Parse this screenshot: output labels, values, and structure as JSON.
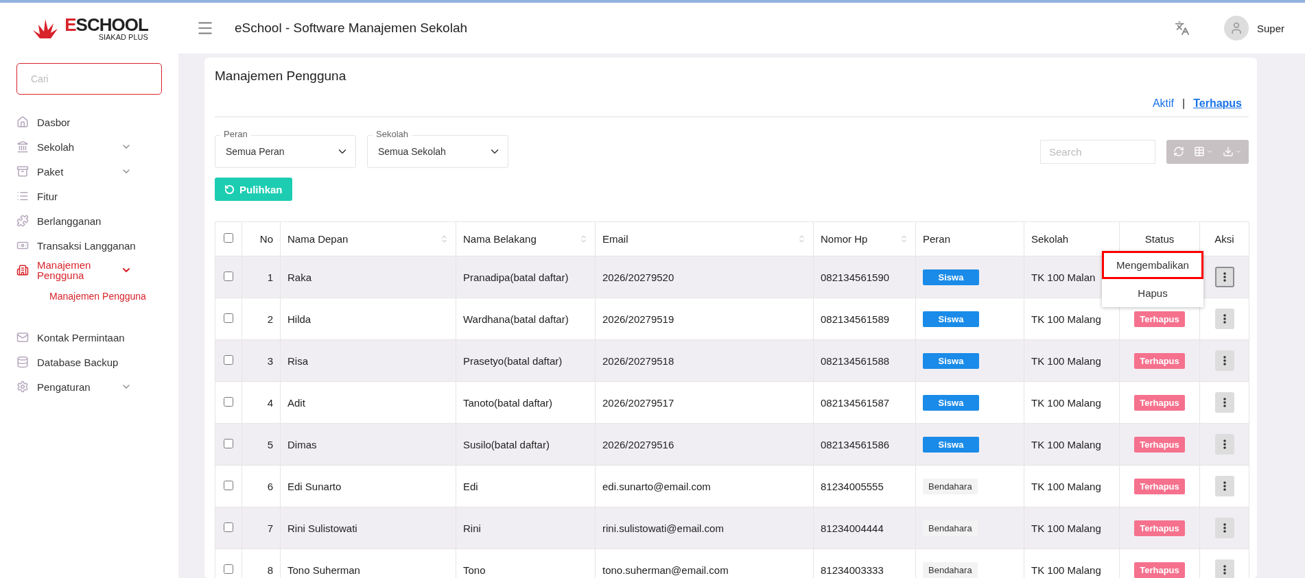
{
  "header": {
    "logo": {
      "brand": "ESCHOOL",
      "tagline": "SIAKAD PLUS"
    },
    "title": "eSchool - Software Manajemen Sekolah",
    "user": "Super"
  },
  "sidebar": {
    "search_placeholder": "Cari",
    "items": [
      {
        "label": "Dasbor",
        "expandable": false,
        "selected": false
      },
      {
        "label": "Sekolah",
        "expandable": true,
        "expanded": false,
        "selected": false
      },
      {
        "label": "Paket",
        "expandable": true,
        "expanded": false,
        "selected": false
      },
      {
        "label": "Fitur",
        "expandable": false,
        "selected": false
      },
      {
        "label": "Berlangganan",
        "expandable": false,
        "selected": false
      },
      {
        "label": "Transaksi Langganan",
        "expandable": false,
        "selected": false
      },
      {
        "label": "Manajemen Pengguna",
        "expandable": true,
        "expanded": true,
        "selected": true,
        "children": [
          {
            "label": "Manajemen Pengguna",
            "selected": true
          }
        ]
      },
      {
        "label": "Kontak Permintaan",
        "expandable": false,
        "selected": false
      },
      {
        "label": "Database Backup",
        "expandable": false,
        "selected": false
      },
      {
        "label": "Pengaturan",
        "expandable": true,
        "expanded": false,
        "selected": false
      }
    ]
  },
  "page": {
    "title": "Manajemen Pengguna",
    "tabs": [
      {
        "label": "Aktif",
        "selected": false
      },
      {
        "label": "Terhapus",
        "selected": true
      }
    ],
    "tab_separator": "|",
    "filters": [
      {
        "label": "Peran",
        "value": "Semua Peran"
      },
      {
        "label": "Sekolah",
        "value": "Semua Sekolah"
      }
    ],
    "restore_button": "Pulihkan",
    "search": {
      "placeholder": "Search"
    }
  },
  "table": {
    "header_checked": false,
    "columns": [
      {
        "label": "No",
        "sortable": false
      },
      {
        "label": "Nama Depan",
        "sortable": true
      },
      {
        "label": "Nama Belakang",
        "sortable": true
      },
      {
        "label": "Email",
        "sortable": true
      },
      {
        "label": "Nomor Hp",
        "sortable": true
      },
      {
        "label": "Peran",
        "sortable": false
      },
      {
        "label": "Sekolah",
        "sortable": false
      },
      {
        "label": "Status",
        "sortable": false
      },
      {
        "label": "Aksi",
        "sortable": false
      }
    ],
    "rows": [
      {
        "checked": false,
        "no": "1",
        "first_name": "Raka",
        "last_name": "Pranadipa(batal daftar)",
        "email": "2026/20279520",
        "phone": "082134561590",
        "role": {
          "label": "Siswa",
          "kind": "primary"
        },
        "school": "TK 100 Malan",
        "action_active": true,
        "menu": [
          {
            "label": "Mengembalikan",
            "highlighted": true
          },
          {
            "label": "Hapus",
            "highlighted": false
          }
        ]
      },
      {
        "checked": false,
        "no": "2",
        "first_name": "Hilda",
        "last_name": "Wardhana(batal daftar)",
        "email": "2026/20279519",
        "phone": "082134561589",
        "role": {
          "label": "Siswa",
          "kind": "primary"
        },
        "school": "TK 100 Malang",
        "status": "Terhapus",
        "action_active": false
      },
      {
        "checked": false,
        "no": "3",
        "first_name": "Risa",
        "last_name": "Prasetyo(batal daftar)",
        "email": "2026/20279518",
        "phone": "082134561588",
        "role": {
          "label": "Siswa",
          "kind": "primary"
        },
        "school": "TK 100 Malang",
        "status": "Terhapus",
        "action_active": false
      },
      {
        "checked": false,
        "no": "4",
        "first_name": "Adit",
        "last_name": "Tanoto(batal daftar)",
        "email": "2026/20279517",
        "phone": "082134561587",
        "role": {
          "label": "Siswa",
          "kind": "primary"
        },
        "school": "TK 100 Malang",
        "status": "Terhapus",
        "action_active": false
      },
      {
        "checked": false,
        "no": "5",
        "first_name": "Dimas",
        "last_name": "Susilo(batal daftar)",
        "email": "2026/20279516",
        "phone": "082134561586",
        "role": {
          "label": "Siswa",
          "kind": "primary"
        },
        "school": "TK 100 Malang",
        "status": "Terhapus",
        "action_active": false
      },
      {
        "checked": false,
        "no": "6",
        "first_name": "Edi Sunarto",
        "last_name": "Edi",
        "email": "edi.sunarto@email.com",
        "phone": "81234005555",
        "role": {
          "label": "Bendahara",
          "kind": "light"
        },
        "school": "TK 100 Malang",
        "status": "Terhapus",
        "action_active": false
      },
      {
        "checked": false,
        "no": "7",
        "first_name": "Rini Sulistowati",
        "last_name": "Rini",
        "email": "rini.sulistowati@email.com",
        "phone": "81234004444",
        "role": {
          "label": "Bendahara",
          "kind": "light"
        },
        "school": "TK 100 Malang",
        "status": "Terhapus",
        "action_active": false
      },
      {
        "checked": false,
        "no": "8",
        "first_name": "Tono Suherman",
        "last_name": "Tono",
        "email": "tono.suherman@email.com",
        "phone": "81234003333",
        "role": {
          "label": "Bendahara",
          "kind": "light"
        },
        "school": "TK 100 Malang",
        "status": "Terhapus",
        "action_active": false
      }
    ]
  }
}
